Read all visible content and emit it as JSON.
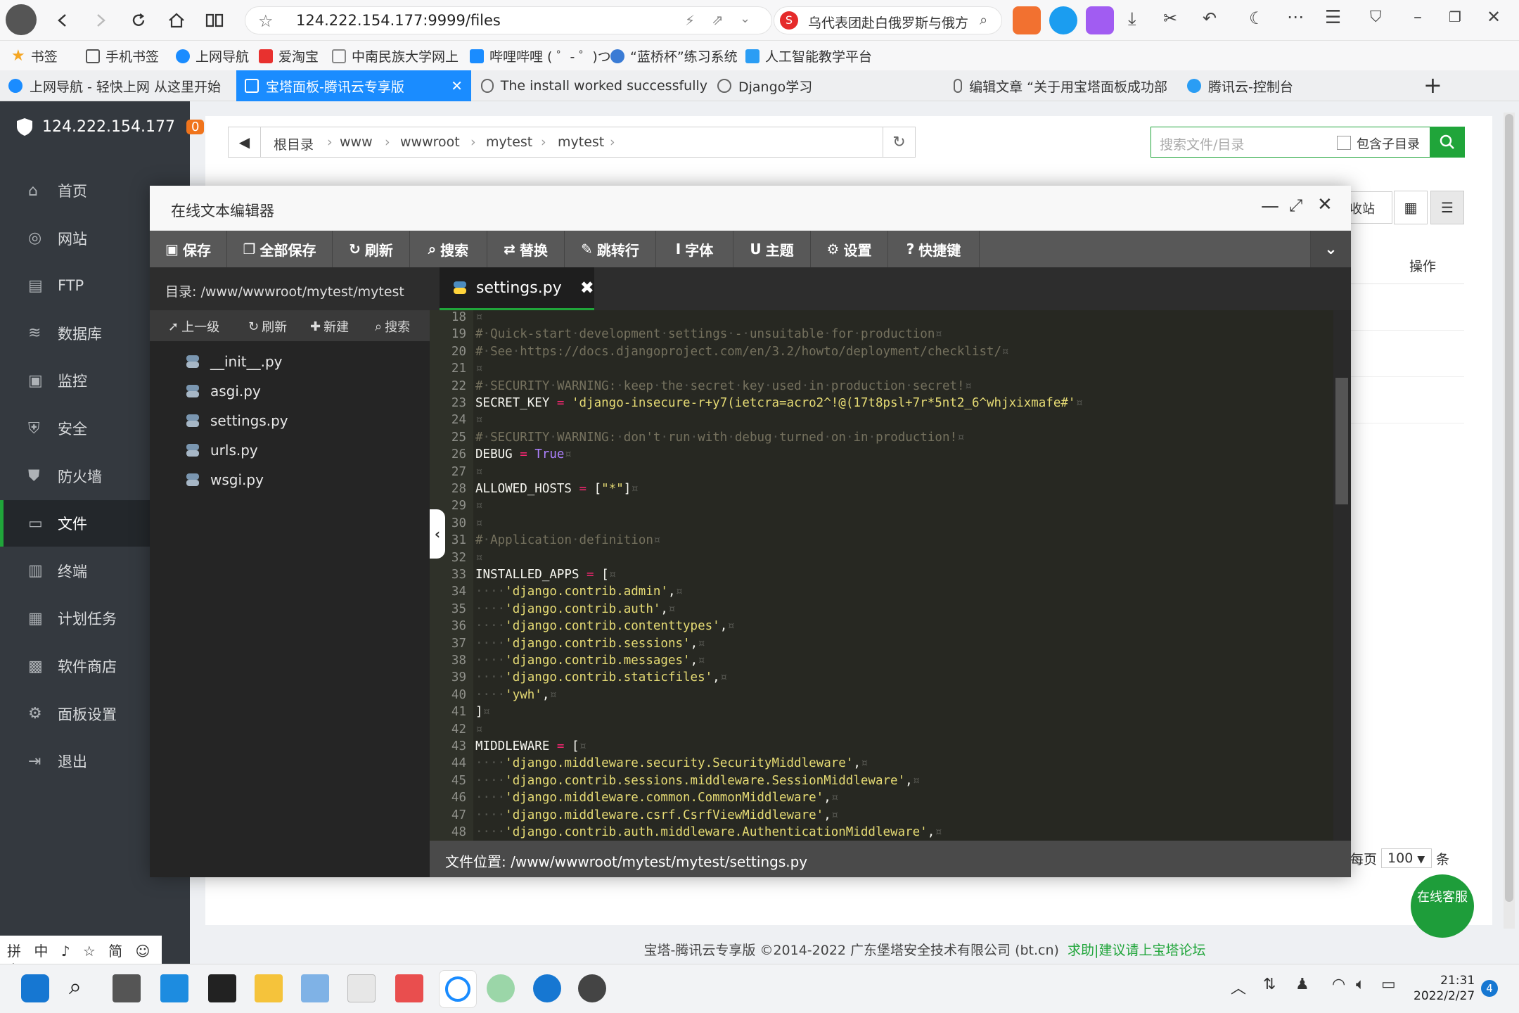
{
  "browser": {
    "url": "124.222.154.177:9999/files",
    "search_hint": "乌代表团赴白俄罗斯与俄方",
    "bookmarks": [
      "书签",
      "手机书签",
      "上网导航",
      "爱淘宝",
      "中南民族大学网上",
      "哔哩哔哩 ( ゜- ゜)つ",
      "“蓝桥杯”练习系统",
      "人工智能教学平台"
    ],
    "tabs": [
      "上网导航 - 轻快上网 从这里开始",
      "宝塔面板-腾讯云专享版",
      "The install worked successfully",
      "Django学习",
      "编辑文章 “关于用宝塔面板成功部",
      "腾讯云-控制台"
    ],
    "new_tab": "+"
  },
  "panel": {
    "ip": "124.222.154.177",
    "badge": "0",
    "nav": [
      "首页",
      "网站",
      "FTP",
      "数据库",
      "监控",
      "安全",
      "防火墙",
      "文件",
      "终端",
      "计划任务",
      "软件商店",
      "面板设置",
      "退出"
    ],
    "active_nav": "文件",
    "ime_bar": "拼 中 ♪ ☆ 简 ☺ ⚙"
  },
  "files": {
    "breadcrumb": [
      "根目录",
      "www",
      "wwwroot",
      "mytest",
      "mytest"
    ],
    "search_placeholder": "搜索文件/目录",
    "include_sub": "包含子目录",
    "bg_button": "收站",
    "col_ops": "操作",
    "per_page_label": "每页",
    "per_page": "100",
    "per_page_unit": "条",
    "chat": "在线客服"
  },
  "editor": {
    "title": "在线文本编辑器",
    "toolbar": [
      "保存",
      "全部保存",
      "刷新",
      "搜索",
      "替换",
      "跳转行",
      "字体",
      "主题",
      "设置",
      "快捷键"
    ],
    "dir_label": "目录: /www/wwwroot/mytest/mytest",
    "dir_tools": [
      "上一级",
      "刷新",
      "新建",
      "搜索"
    ],
    "files": [
      "__init__.py",
      "asgi.py",
      "settings.py",
      "urls.py",
      "wsgi.py"
    ],
    "open_tab": "settings.py",
    "status": "文件位置: /www/wwwroot/mytest/mytest/settings.py",
    "code_lines": [
      {
        "n": "18",
        "t": ""
      },
      {
        "n": "19",
        "t": "# Quick-start development settings - unsuitable for production"
      },
      {
        "n": "20",
        "t": "# See https://docs.djangoproject.com/en/3.2/howto/deployment/checklist/"
      },
      {
        "n": "21",
        "t": ""
      },
      {
        "n": "22",
        "t": "# SECURITY WARNING: keep the secret key used in production secret!"
      },
      {
        "n": "23",
        "t": "SECRET_KEY = 'django-insecure-r+y7(ietcra=acro2^!@(17t8psl+7r*5nt2_6^whjxixmafe#'"
      },
      {
        "n": "24",
        "t": ""
      },
      {
        "n": "25",
        "t": "# SECURITY WARNING: don't run with debug turned on in production!"
      },
      {
        "n": "26",
        "t": "DEBUG = True"
      },
      {
        "n": "27",
        "t": ""
      },
      {
        "n": "28",
        "t": "ALLOWED_HOSTS = [\"*\"]"
      },
      {
        "n": "29",
        "t": ""
      },
      {
        "n": "30",
        "t": ""
      },
      {
        "n": "31",
        "t": "# Application definition"
      },
      {
        "n": "32",
        "t": ""
      },
      {
        "n": "33",
        "t": "INSTALLED_APPS = ["
      },
      {
        "n": "34",
        "t": "    'django.contrib.admin',"
      },
      {
        "n": "35",
        "t": "    'django.contrib.auth',"
      },
      {
        "n": "36",
        "t": "    'django.contrib.contenttypes',"
      },
      {
        "n": "37",
        "t": "    'django.contrib.sessions',"
      },
      {
        "n": "38",
        "t": "    'django.contrib.messages',"
      },
      {
        "n": "39",
        "t": "    'django.contrib.staticfiles',"
      },
      {
        "n": "40",
        "t": "    'ywh',"
      },
      {
        "n": "41",
        "t": "]"
      },
      {
        "n": "42",
        "t": ""
      },
      {
        "n": "43",
        "t": "MIDDLEWARE = ["
      },
      {
        "n": "44",
        "t": "    'django.middleware.security.SecurityMiddleware',"
      },
      {
        "n": "45",
        "t": "    'django.contrib.sessions.middleware.SessionMiddleware',"
      },
      {
        "n": "46",
        "t": "    'django.middleware.common.CommonMiddleware',"
      },
      {
        "n": "47",
        "t": "    'django.middleware.csrf.CsrfViewMiddleware',"
      },
      {
        "n": "48",
        "t": "    'django.contrib.auth.middleware.AuthenticationMiddleware',"
      }
    ]
  },
  "panel_footer": {
    "copyright": "宝塔-腾讯云专享版 ©2014-2022 广东堡塔安全技术有限公司 (bt.cn)",
    "link": "求助|建议请上宝塔论坛"
  },
  "taskbar": {
    "time": "21:31",
    "date": "2022/2/27",
    "notify": "4"
  },
  "colors": {
    "accent_green": "#20a53a",
    "tab_blue": "#1a8cff",
    "sidebar": "#34393f",
    "editor_bg": "#272822"
  }
}
